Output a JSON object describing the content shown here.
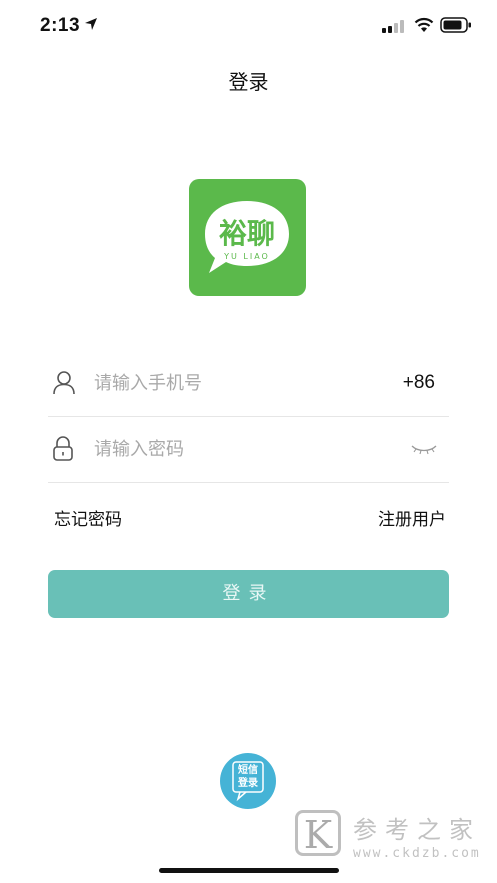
{
  "status_bar": {
    "time": "2:13"
  },
  "nav": {
    "title": "登录"
  },
  "logo": {
    "text_cn": "裕聊",
    "text_en": "YU LIAO"
  },
  "form": {
    "phone_placeholder": "请输入手机号",
    "country_code": "+86",
    "password_placeholder": "请输入密码"
  },
  "links": {
    "forgot_password": "忘记密码",
    "register": "注册用户"
  },
  "login_button": {
    "label": "登录"
  },
  "sms_login": {
    "line1": "短信",
    "line2": "登录"
  },
  "watermark": {
    "mark": "K",
    "text": "参考之家",
    "url": "www.ckdzb.com"
  },
  "colors": {
    "logo_green": "#5bb94b",
    "button_teal": "#69c0b7",
    "sms_blue": "#45b3d6"
  },
  "icons": [
    "location-arrow-icon",
    "signal-icon",
    "wifi-icon",
    "battery-icon",
    "user-icon",
    "lock-icon",
    "eye-closed-icon"
  ]
}
